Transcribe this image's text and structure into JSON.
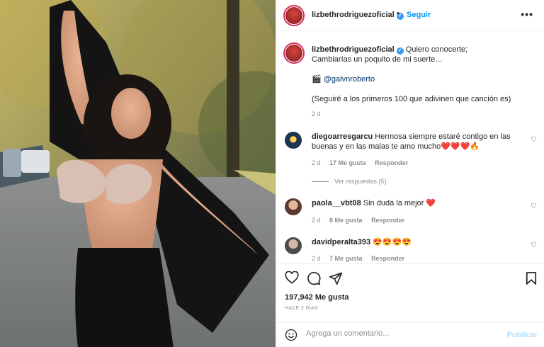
{
  "post": {
    "username": "lizbethrodriguezoficial",
    "header_dot": "•",
    "follow_label": "Seguir",
    "more_label": "•••"
  },
  "caption": {
    "username": "lizbethrodriguezoficial",
    "line1": "Quiero conocerte;",
    "line2": "Cambiarías un poquito de mi suerte…",
    "photo_credit_icon": "clapperboard-icon",
    "photo_credit_emoji": "🎬",
    "photo_credit_handle": "@galvnroberto",
    "line4": "(Seguiré a los primeros 100 que adivinen que canción es)",
    "time": "2 d"
  },
  "comments": [
    {
      "username": "diegoarresgarcu",
      "text": "Hermosa siempre estaré contigo en las buenas y en las malas te amo mucho❤️❤️❤️🔥",
      "time": "2 d",
      "likes": "17 Me gusta",
      "reply": "Responder",
      "view_replies": "Ver respuestas (5)"
    },
    {
      "username": "paola__vbt08",
      "text": "Sin duda la mejor ❤️",
      "time": "2 d",
      "likes": "8 Me gusta",
      "reply": "Responder"
    },
    {
      "username": "davidperalta393",
      "text": "😍😍😍😍",
      "time": "2 d",
      "likes": "7 Me gusta",
      "reply": "Responder"
    }
  ],
  "stats": {
    "likes": "197,942 Me gusta",
    "ago": "HACE 2 DÍAS"
  },
  "add_comment": {
    "placeholder": "Agrega un comentario...",
    "publish_label": "Publicar"
  },
  "colors": {
    "accent": "#0095f6",
    "verified": "#3897f0",
    "muted": "#8e8e8e",
    "text": "#262626"
  }
}
